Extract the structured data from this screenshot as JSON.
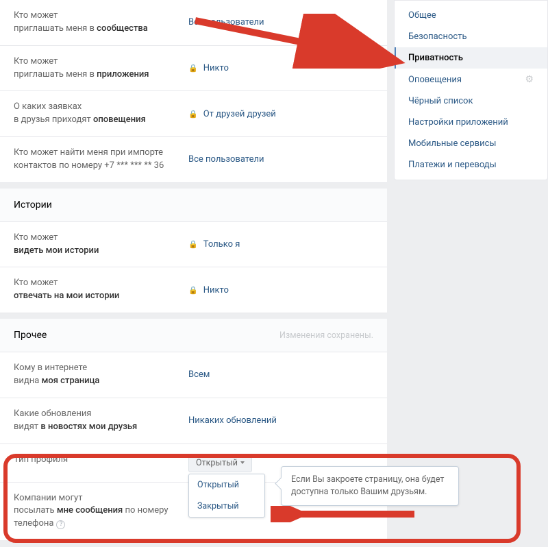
{
  "sidebar": {
    "items": [
      {
        "label": "Общее"
      },
      {
        "label": "Безопасность"
      },
      {
        "label": "Приватность"
      },
      {
        "label": "Оповещения"
      },
      {
        "label": "Чёрный список"
      },
      {
        "label": "Настройки приложений"
      },
      {
        "label": "Мобильные сервисы"
      },
      {
        "label": "Платежи и переводы"
      }
    ]
  },
  "settings": {
    "invite_groups": {
      "label_prefix": "Кто может",
      "label_action": "приглашать меня в ",
      "label_bold": "сообщества",
      "value": "Все пользователи"
    },
    "invite_apps": {
      "label_prefix": "Кто может",
      "label_action": "приглашать меня в ",
      "label_bold": "приложения",
      "value": "Никто"
    },
    "friend_req_notif": {
      "label_line1": "О каких заявках",
      "label_line2_pre": "в друзья приходят ",
      "label_bold": "оповещения",
      "value": "От друзей друзей"
    },
    "find_by_phone": {
      "label_line1": "Кто может найти меня при импорте",
      "label_line2": "контактов по номеру +7 *** *** ** 36",
      "value": "Все пользователи"
    }
  },
  "stories": {
    "title": "Истории",
    "see": {
      "label_prefix": "Кто может",
      "label_bold": "видеть мои истории",
      "value": "Только я"
    },
    "reply": {
      "label_prefix": "Кто может",
      "label_bold": "отвечать на мои истории",
      "value": "Никто"
    }
  },
  "other": {
    "title": "Прочее",
    "saved": "Изменения сохранены.",
    "page_visible": {
      "label_line1": "Кому в интернете",
      "label_line2_pre": "видна ",
      "label_bold": "моя страница",
      "value": "Всем"
    },
    "feed_updates": {
      "label_line1": "Какие обновления",
      "label_line2_pre": "видят ",
      "label_bold": "в новостях мои друзья",
      "value": "Никаких обновлений"
    },
    "profile_type": {
      "label": "Тип профиля",
      "selected": "Открытый",
      "options": [
        "Открытый",
        "Закрытый"
      ],
      "tooltip": "Если Вы закроете страницу, она будет доступна только Вашим друзьям."
    },
    "companies_msg": {
      "label_line1": "Компании могут",
      "label_line2_pre": "посылать ",
      "label_bold": "мне сообщения",
      "label_line2_post": " по номеру",
      "label_line3": "телефона"
    }
  }
}
